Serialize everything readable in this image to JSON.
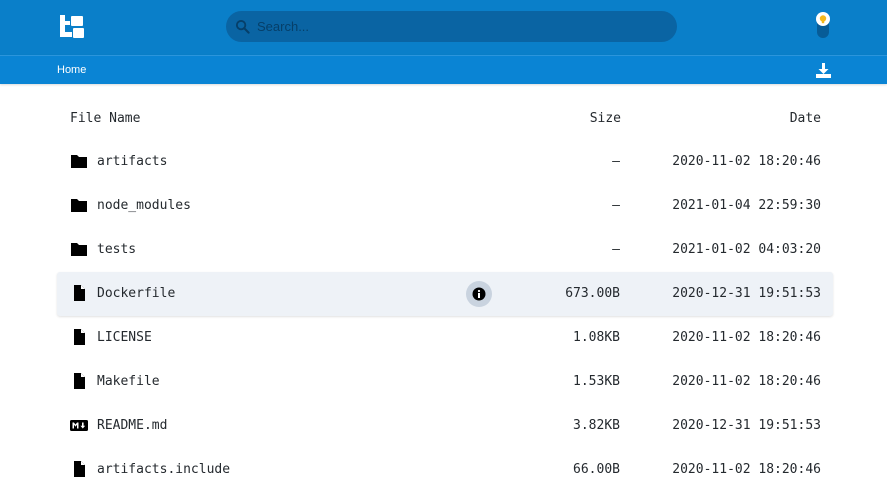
{
  "search": {
    "placeholder": "Search..."
  },
  "breadcrumb": {
    "home": "Home"
  },
  "columns": {
    "name": "File Name",
    "size": "Size",
    "date": "Date"
  },
  "files": [
    {
      "name": "artifacts",
      "size": "—",
      "date": "2020-11-02 18:20:46",
      "icon": "folder-icon",
      "active": false
    },
    {
      "name": "node_modules",
      "size": "—",
      "date": "2021-01-04 22:59:30",
      "icon": "folder-icon",
      "active": false
    },
    {
      "name": "tests",
      "size": "—",
      "date": "2021-01-02 04:03:20",
      "icon": "folder-icon",
      "active": false
    },
    {
      "name": "Dockerfile",
      "size": "673.00B",
      "date": "2020-12-31 19:51:53",
      "icon": "file-icon",
      "active": true
    },
    {
      "name": "LICENSE",
      "size": "1.08KB",
      "date": "2020-11-02 18:20:46",
      "icon": "file-icon",
      "active": false
    },
    {
      "name": "Makefile",
      "size": "1.53KB",
      "date": "2020-11-02 18:20:46",
      "icon": "file-icon",
      "active": false
    },
    {
      "name": "README.md",
      "size": "3.82KB",
      "date": "2020-12-31 19:51:53",
      "icon": "markdown-icon",
      "active": false
    },
    {
      "name": "artifacts.include",
      "size": "66.00B",
      "date": "2020-11-02 18:20:46",
      "icon": "file-icon",
      "active": false
    }
  ],
  "colors": {
    "header": "#0a7fc9",
    "subbar": "#0a84d4",
    "search_bg": "#0a64a3",
    "row_active": "#eef2f7"
  }
}
